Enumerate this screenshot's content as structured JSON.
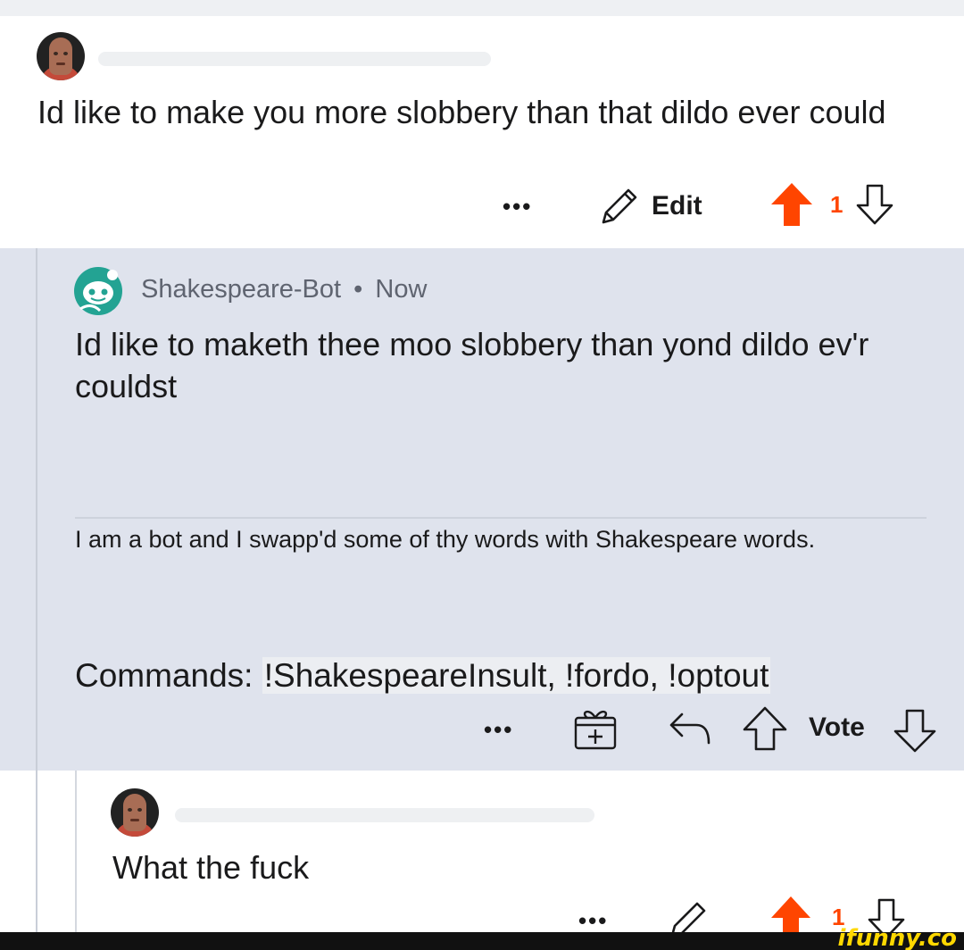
{
  "comment1": {
    "avatar_icon": "user-avatar",
    "body": "Id like to make you more slobbery than that dildo ever could",
    "actions": {
      "more": "•••",
      "edit_label": "Edit",
      "edit_icon": "pencil-icon",
      "score": "1",
      "upvote_icon": "upvote-filled-icon",
      "downvote_icon": "downvote-icon"
    }
  },
  "bot_reply": {
    "username": "Shakespeare-Bot",
    "separator": "•",
    "time": "Now",
    "body": "Id like to maketh thee moo slobbery than yond dildo ev'r couldst",
    "footer_text": "I am a bot and I swapp'd some of thy words with Shakespeare words.",
    "commands_label": "Commands:",
    "commands": "!ShakespeareInsult, !fordo, !optout",
    "actions": {
      "more": "•••",
      "award_icon": "award-icon",
      "reply_icon": "reply-icon",
      "upvote_icon": "upvote-icon",
      "vote_label": "Vote",
      "downvote_icon": "downvote-icon"
    }
  },
  "comment3": {
    "body": "What the fuck",
    "actions": {
      "more": "•••",
      "score": "1"
    }
  },
  "watermark": "ifunny.co",
  "colors": {
    "upvote": "#ff4500",
    "reply_bg": "#dfe3ed",
    "bot_avatar": "#23a393"
  }
}
